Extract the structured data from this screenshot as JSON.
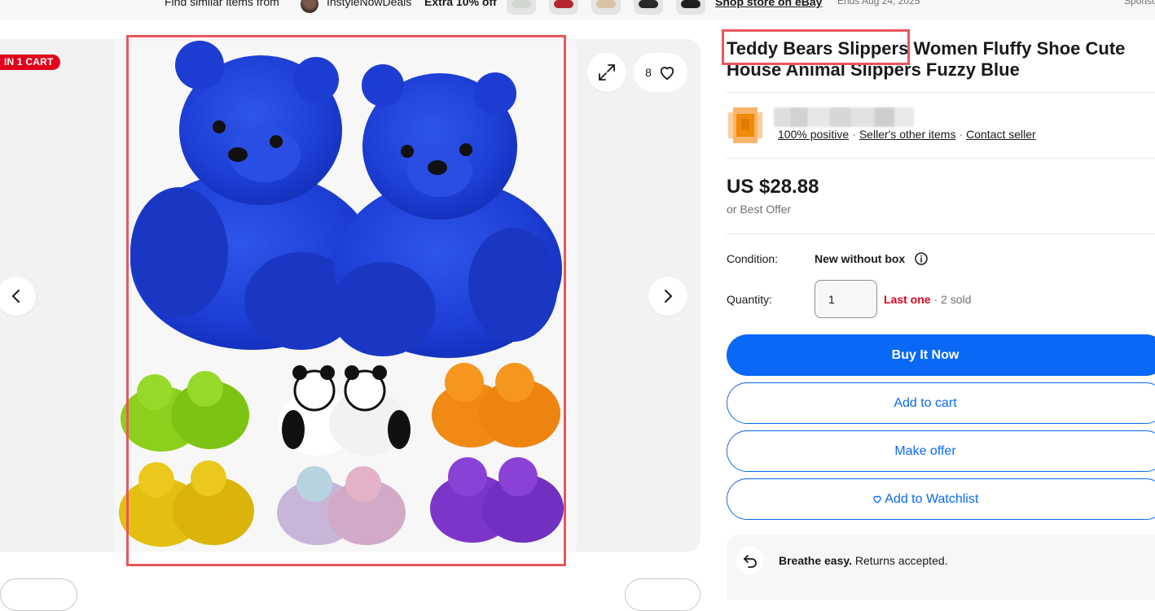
{
  "top_strip": {
    "find_similar": "Find similar items from",
    "seller_name": "InstyleNowDeals",
    "promo": "Extra 10% off",
    "shop_link": "Shop store on eBay",
    "ends": "Ends Aug 24, 2025",
    "sponsored": "Sponso"
  },
  "gallery": {
    "cart_badge": "IN 1 CART",
    "watch_count": "8",
    "image_icon": "teddy-bear-slippers-image"
  },
  "listing": {
    "title": "Teddy Bears Slippers Women Fluffy Shoe Cute House Animal Slippers Fuzzy Blue",
    "seller": {
      "positive": "100% positive",
      "other_items": "Seller's other items",
      "contact": "Contact seller",
      "separator": "·"
    },
    "price": "US $28.88",
    "best_offer": "or Best Offer",
    "condition_label": "Condition:",
    "condition_value": "New without box",
    "quantity_label": "Quantity:",
    "quantity_value": "1",
    "last_one": "Last one",
    "sold": "· 2 sold",
    "buttons": {
      "buy_now": "Buy It Now",
      "add_to_cart": "Add to cart",
      "make_offer": "Make offer",
      "watchlist": "Add to Watchlist"
    },
    "returns": {
      "bold": "Breathe easy.",
      "text": " Returns accepted."
    }
  },
  "colors": {
    "accent": "#0968f6",
    "badge": "#e0001b",
    "highlight": "#e8575a"
  }
}
